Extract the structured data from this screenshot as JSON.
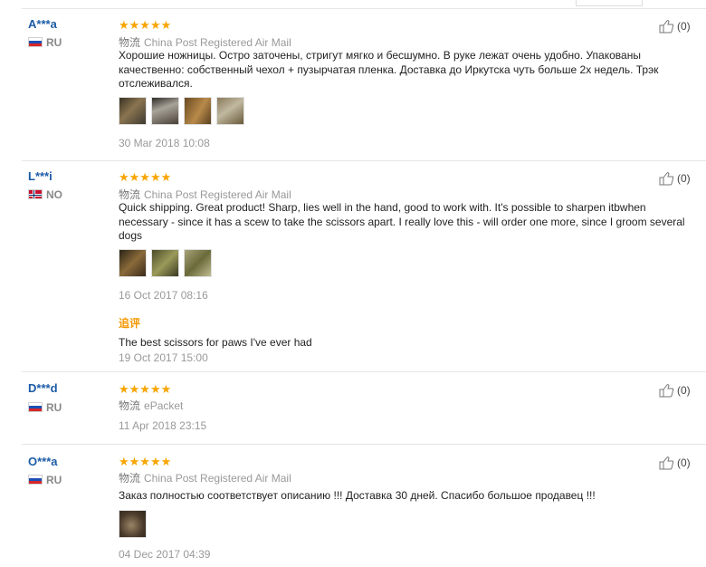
{
  "ui": {
    "accent": "#1c5ba6",
    "star_color": "#f7a500",
    "followup_color": "#f39800"
  },
  "reviews": [
    {
      "user": "A***a",
      "country": "RU",
      "flag": "russia-flag",
      "stars": "★★★★★",
      "ship_label": "物流",
      "shipping": "China Post Registered Air Mail",
      "text": "Хорошие ножницы. Остро заточены, стригут мягко и бесшумно. В руке лежат очень удобно. Упакованы качественно: собственный чехол + пузырчатая пленка. Доставка до Иркутска чуть больше 2х недель. Трэк отслеживался.",
      "date": "30 Mar 2018 10:08",
      "helpful": "(0)",
      "photos": [
        "#6b5a3c",
        "#5e5549",
        "#8a6a3a",
        "#7a6a50"
      ]
    },
    {
      "user": "L***i",
      "country": "NO",
      "flag": "norway-flag",
      "stars": "★★★★★",
      "ship_label": "物流",
      "shipping": "China Post Registered Air Mail",
      "text": "Quick shipping. Great product! Sharp, lies well in the hand, good to work with. It's possible to sharpen itbwhen necessary - since it has a scew to take the scissors apart. I really love this - will order one more, since I groom several dogs",
      "date": "16 Oct 2017 08:16",
      "followup_label": "追评",
      "followup_text": "The best scissors for paws I've ever had",
      "followup_date": "19 Oct 2017 15:00",
      "helpful": "(0)",
      "photos": [
        "#5c4a2e",
        "#6e6a3a",
        "#8e8a5a"
      ]
    },
    {
      "user": "D***d",
      "country": "RU",
      "flag": "russia-flag",
      "stars": "★★★★★",
      "ship_label": "物流",
      "shipping": "ePacket",
      "date": "11 Apr 2018 23:15",
      "helpful": "(0)"
    },
    {
      "user": "O***a",
      "country": "RU",
      "flag": "russia-flag",
      "stars": "★★★★★",
      "ship_label": "物流",
      "shipping": "China Post Registered Air Mail",
      "text": "Заказ полностью соответствует описанию !!! Доставка 30 дней. Спасибо большое продавец !!!",
      "date": "04 Dec 2017 04:39",
      "helpful": "(0)",
      "photos": [
        "#5a4a3a"
      ]
    }
  ]
}
